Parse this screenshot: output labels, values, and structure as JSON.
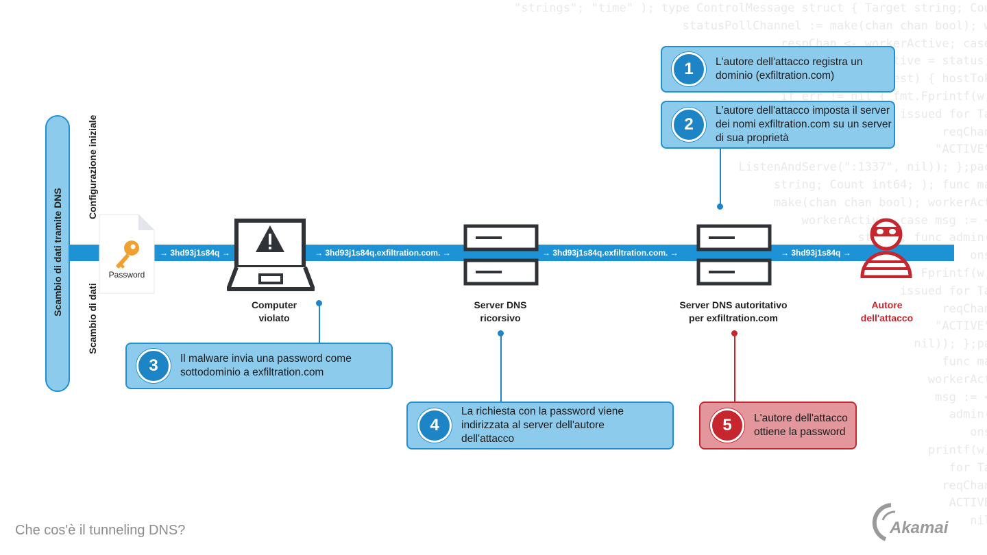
{
  "background_code_lines": [
    "  \"strings\"; \"time\" ); type ControlMessage struct { Target string; Cou",
    "statusPollChannel := make(chan chan bool); w",
    "respChan <- workerActive; case",
    "workerActive = status;",
    "Request) { hostTok",
    "if err != nil { fmt.Fprintf(w,",
    "issued for Ta",
    "reqChan",
    "\"ACTIVE\"",
    "ListenAndServe(\":1337\", nil)); };pac",
    "string; Count int64; ); func ma",
    "make(chan chan bool); workerAct",
    "workerActive; case msg := <",
    "status; func admin(",
    "ons",
    "Fprintf(w,",
    "issued for Ta",
    "reqChan",
    "\"ACTIVE\"",
    "nil)); };pa",
    "func ma",
    "workerAct",
    "msg := <",
    "admin(",
    "ons",
    "printf(w,",
    "for Ta",
    "reqChan",
    "ACTIVE",
    "nil"
  ],
  "sidebar": {
    "main_label": "Scambio di dati tramite DNS",
    "phase_setup": "Configurazione iniziale",
    "phase_exchange": "Scambio di dati"
  },
  "nodes": {
    "password_doc": {
      "label": "Password",
      "icon": "key-icon"
    },
    "compromised_computer": {
      "label_line1": "Computer",
      "label_line2": "violato",
      "icon": "laptop-warning-icon"
    },
    "recursive_dns": {
      "label_line1": "Server DNS",
      "label_line2": "ricorsivo",
      "icon": "server-icon"
    },
    "authoritative_dns": {
      "label_line1": "Server DNS autoritativo",
      "label_line2": "per exfiltration.com",
      "icon": "server-icon"
    },
    "attacker": {
      "label_line1": "Autore",
      "label_line2": "dell'attacco",
      "icon": "burglar-icon"
    }
  },
  "flow_labels": [
    "→ 3hd93j1s84q →",
    "→ 3hd93j1s84q.exfiltration.com. →",
    "→ 3hd93j1s84q.exfiltration.com. →",
    "→ 3hd93j1s84q →"
  ],
  "steps": [
    {
      "number": "1",
      "text": "L'autore dell'attacco registra un dominio (exfiltration.com)"
    },
    {
      "number": "2",
      "text": "L'autore dell'attacco imposta il server dei nomi exfiltration.com su un server di sua proprietà"
    },
    {
      "number": "3",
      "text": "Il malware invia una password come sottodominio a exfiltration.com"
    },
    {
      "number": "4",
      "text": "La richiesta con la password viene indirizzata al server dell'autore dell'attacco"
    },
    {
      "number": "5",
      "text": "L'autore dell'attacco ottiene la password"
    }
  ],
  "colors": {
    "flow_blue": "#1d93d6",
    "card_blue": "#8dcbec",
    "attacker_red": "#c6262e",
    "card_red": "#e3979d",
    "key_orange": "#f0a030",
    "icon_dark": "#2f3237"
  },
  "footer": {
    "title": "Che cos'è il tunneling DNS?",
    "brand": "Akamai"
  }
}
